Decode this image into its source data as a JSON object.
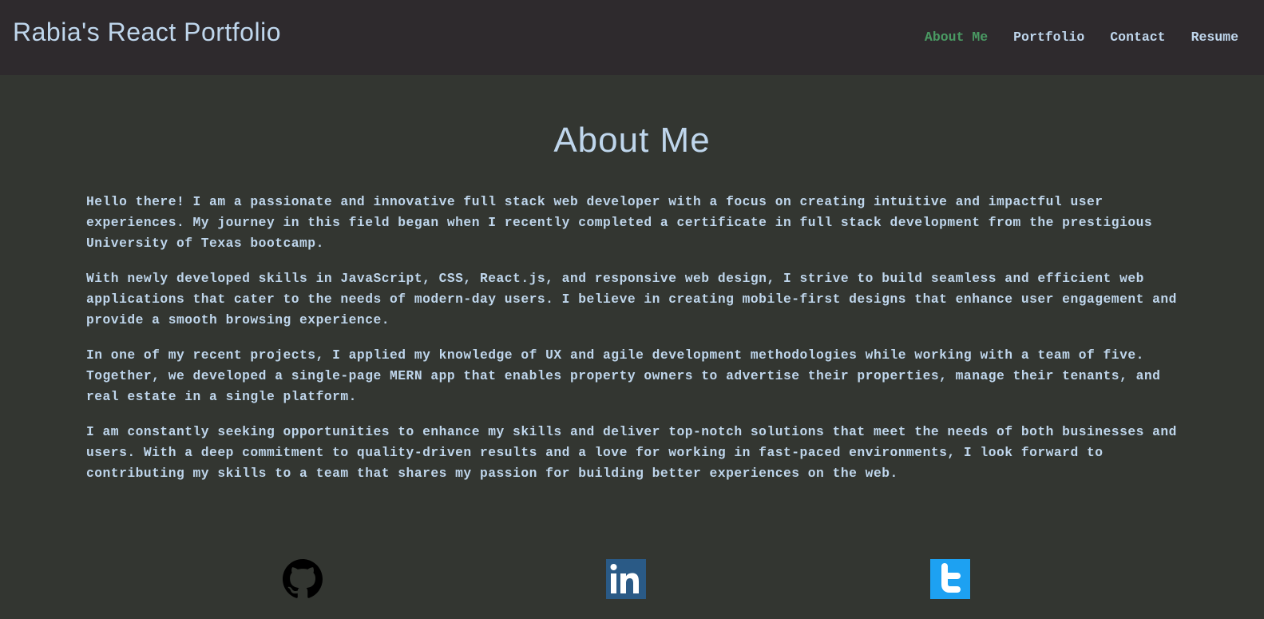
{
  "header": {
    "title": "Rabia's React Portfolio",
    "nav": [
      {
        "label": "About Me",
        "active": true
      },
      {
        "label": "Portfolio",
        "active": false
      },
      {
        "label": "Contact",
        "active": false
      },
      {
        "label": "Resume",
        "active": false
      }
    ]
  },
  "main": {
    "heading": "About Me",
    "paragraphs": [
      "Hello there! I am a passionate and innovative full stack web developer with a focus on creating intuitive and impactful user experiences. My journey in this field began when I recently completed a certificate in full stack development from the prestigious University of Texas bootcamp.",
      "With newly developed skills in JavaScript, CSS, React.js, and responsive web design, I strive to build seamless and efficient web applications that cater to the needs of modern-day users. I believe in creating mobile-first designs that enhance user engagement and provide a smooth browsing experience.",
      "In one of my recent projects, I applied my knowledge of UX and agile development methodologies while working with a team of five. Together, we developed a single-page MERN app that enables property owners to advertise their properties, manage their tenants, and real estate in a single platform.",
      "I am constantly seeking opportunities to enhance my skills and deliver top-notch solutions that meet the needs of both businesses and users. With a deep commitment to quality-driven results and a love for working in fast-paced environments, I look forward to contributing my skills to a team that shares my passion for building better experiences on the web."
    ]
  },
  "social": {
    "icons": [
      "github-icon",
      "linkedin-icon",
      "twitter-icon"
    ]
  },
  "colors": {
    "header_bg": "#2e2a2d",
    "page_bg": "#333631",
    "text": "#bfd6ec",
    "active_nav": "#4a9a63",
    "linkedin": "#2a5a86",
    "twitter": "#1da1f2"
  }
}
